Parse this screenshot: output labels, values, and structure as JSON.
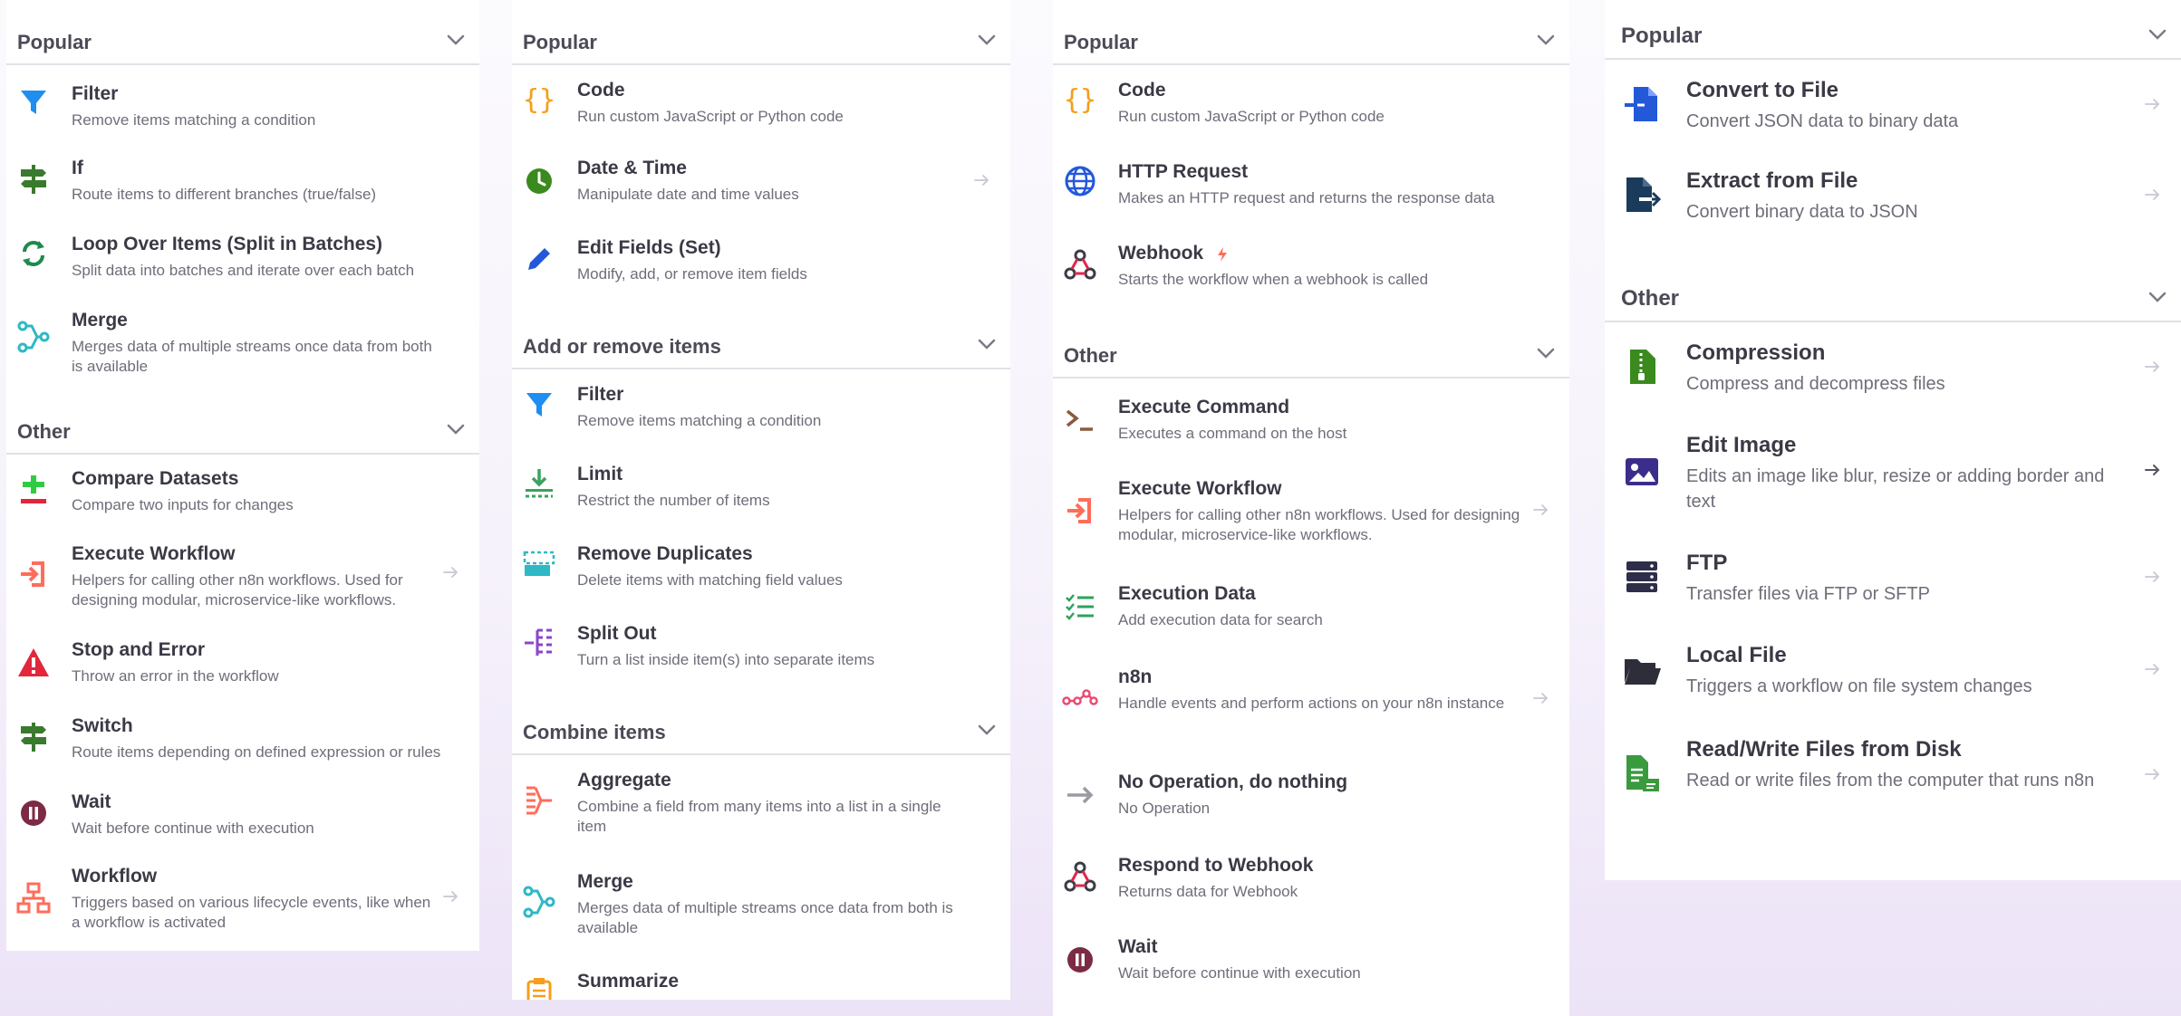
{
  "panel1": {
    "sections": [
      {
        "title": "Popular",
        "items": [
          {
            "title": "Filter",
            "desc": "Remove items matching a condition"
          },
          {
            "title": "If",
            "desc": "Route items to different branches (true/false)"
          },
          {
            "title": "Loop Over Items (Split in Batches)",
            "desc": "Split data into batches and iterate over each batch"
          },
          {
            "title": "Merge",
            "desc": "Merges data of multiple streams once data from both is available"
          }
        ]
      },
      {
        "title": "Other",
        "items": [
          {
            "title": "Compare Datasets",
            "desc": "Compare two inputs for changes"
          },
          {
            "title": "Execute Workflow",
            "desc": "Helpers for calling other n8n workflows. Used for designing modular, microservice-like workflows."
          },
          {
            "title": "Stop and Error",
            "desc": "Throw an error in the workflow"
          },
          {
            "title": "Switch",
            "desc": "Route items depending on defined expression or rules"
          },
          {
            "title": "Wait",
            "desc": "Wait before continue with execution"
          },
          {
            "title": "Workflow",
            "desc": "Triggers based on various lifecycle events, like when a workflow is activated"
          }
        ]
      }
    ]
  },
  "panel2": {
    "sections": [
      {
        "title": "Popular",
        "items": [
          {
            "title": "Code",
            "desc": "Run custom JavaScript or Python code"
          },
          {
            "title": "Date & Time",
            "desc": "Manipulate date and time values"
          },
          {
            "title": "Edit Fields (Set)",
            "desc": "Modify, add, or remove item fields"
          }
        ]
      },
      {
        "title": "Add or remove items",
        "items": [
          {
            "title": "Filter",
            "desc": "Remove items matching a condition"
          },
          {
            "title": "Limit",
            "desc": "Restrict the number of items"
          },
          {
            "title": "Remove Duplicates",
            "desc": "Delete items with matching field values"
          },
          {
            "title": "Split Out",
            "desc": "Turn a list inside item(s) into separate items"
          }
        ]
      },
      {
        "title": "Combine items",
        "items": [
          {
            "title": "Aggregate",
            "desc": "Combine a field from many items into a list in a single item"
          },
          {
            "title": "Merge",
            "desc": "Merges data of multiple streams once data from both is available"
          },
          {
            "title": "Summarize",
            "desc": ""
          }
        ]
      }
    ]
  },
  "panel3": {
    "sections": [
      {
        "title": "Popular",
        "items": [
          {
            "title": "Code",
            "desc": "Run custom JavaScript or Python code"
          },
          {
            "title": "HTTP Request",
            "desc": "Makes an HTTP request and returns the response data"
          },
          {
            "title": "Webhook",
            "desc": "Starts the workflow when a webhook is called"
          }
        ]
      },
      {
        "title": "Other",
        "items": [
          {
            "title": "Execute Command",
            "desc": "Executes a command on the host"
          },
          {
            "title": "Execute Workflow",
            "desc": "Helpers for calling other n8n workflows. Used for designing modular, microservice-like workflows."
          },
          {
            "title": "Execution Data",
            "desc": "Add execution data for search"
          },
          {
            "title": "n8n",
            "desc": "Handle events and perform actions on your n8n instance"
          },
          {
            "title": "No Operation, do nothing",
            "desc": "No Operation"
          },
          {
            "title": "Respond to Webhook",
            "desc": "Returns data for Webhook"
          },
          {
            "title": "Wait",
            "desc": "Wait before continue with execution"
          }
        ]
      }
    ]
  },
  "panel4": {
    "sections": [
      {
        "title": "Popular",
        "items": [
          {
            "title": "Convert to File",
            "desc": "Convert JSON data to binary data"
          },
          {
            "title": "Extract from File",
            "desc": "Convert binary data to JSON"
          }
        ]
      },
      {
        "title": "Other",
        "items": [
          {
            "title": "Compression",
            "desc": "Compress and decompress files"
          },
          {
            "title": "Edit Image",
            "desc": "Edits an image like blur, resize or adding border and text"
          },
          {
            "title": "FTP",
            "desc": "Transfer files via FTP or SFTP"
          },
          {
            "title": "Local File",
            "desc": "Triggers a workflow on file system changes"
          },
          {
            "title": "Read/Write Files from Disk",
            "desc": "Read or write files from the computer that runs n8n"
          }
        ]
      }
    ]
  },
  "colors": {
    "blue": "#1e8ef0",
    "green": "#3a8a3e",
    "orange": "#f59e1b",
    "red": "#e2263b",
    "salmon": "#ff6d5a",
    "teal": "#2fb8c5",
    "purple": "#8a47c8",
    "navy": "#1a3b5c",
    "maroon": "#7c2b45"
  }
}
